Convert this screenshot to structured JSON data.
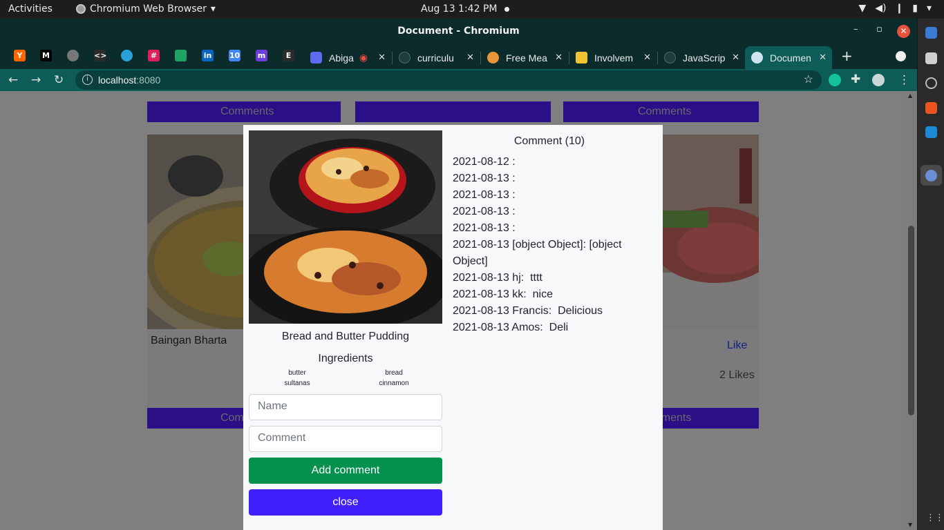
{
  "os": {
    "activities": "Activities",
    "app_menu": "Chromium Web Browser",
    "clock": "Aug 13  1:42 PM"
  },
  "window": {
    "title": "Document - Chromium"
  },
  "tabs": [
    {
      "title": "Abiga",
      "favicon_color": "#5c6bf0"
    },
    {
      "title": "curriculu",
      "favicon_color": "#1f3c3c"
    },
    {
      "title": "Free Mea",
      "favicon_color": "#e8953a"
    },
    {
      "title": "Involvem",
      "favicon_color": "#f1c232"
    },
    {
      "title": "JavaScrip",
      "favicon_color": "#1f3c3c"
    },
    {
      "title": "Documen",
      "favicon_color": "#cfe3f0"
    }
  ],
  "pinned_tabs": [
    {
      "icon": "Y",
      "color": "#ff6600"
    },
    {
      "icon": "M",
      "color": "#000000"
    },
    {
      "icon": "",
      "color": "#777777"
    },
    {
      "icon": "<>",
      "color": "#2b2b2b"
    },
    {
      "icon": "",
      "color": "#2aa0da"
    },
    {
      "icon": "#",
      "color": "#e01e5a"
    },
    {
      "icon": "",
      "color": "#1fa463"
    },
    {
      "icon": "in",
      "color": "#0a66c2"
    },
    {
      "icon": "10",
      "color": "#4285f4"
    },
    {
      "icon": "m",
      "color": "#6c3cdc"
    },
    {
      "icon": "E",
      "color": "#2b2b2b"
    }
  ],
  "address_bar": {
    "host": "localhost",
    "port": ":8080"
  },
  "background": {
    "comment_label": "Comments",
    "dish_left": "Baingan Bharta",
    "like_label": "Like",
    "likes_count": "2 Likes"
  },
  "modal": {
    "dish_name": "Bread and Butter Pudding",
    "ingredients_heading": "Ingredients",
    "ingredients": [
      "butter",
      "bread",
      "sultanas",
      "cinnamon"
    ],
    "name_placeholder": "Name",
    "comment_placeholder": "Comment",
    "add_button": "Add comment",
    "close_button": "close",
    "comments_heading": "Comment (10)",
    "comments": [
      {
        "date": "2021-08-12",
        "text": " :"
      },
      {
        "date": "2021-08-13",
        "text": " :"
      },
      {
        "date": "2021-08-13",
        "text": " :"
      },
      {
        "date": "2021-08-13",
        "text": " :"
      },
      {
        "date": "2021-08-13",
        "text": " :"
      },
      {
        "date": "2021-08-13",
        "text": " [object Object]:  [object Object]"
      },
      {
        "date": "2021-08-13",
        "text": " hj:  tttt"
      },
      {
        "date": "2021-08-13",
        "text": " kk:  nice"
      },
      {
        "date": "2021-08-13",
        "text": " Francis:  Delicious"
      },
      {
        "date": "2021-08-13",
        "text": " Amos:  Deli"
      }
    ]
  }
}
